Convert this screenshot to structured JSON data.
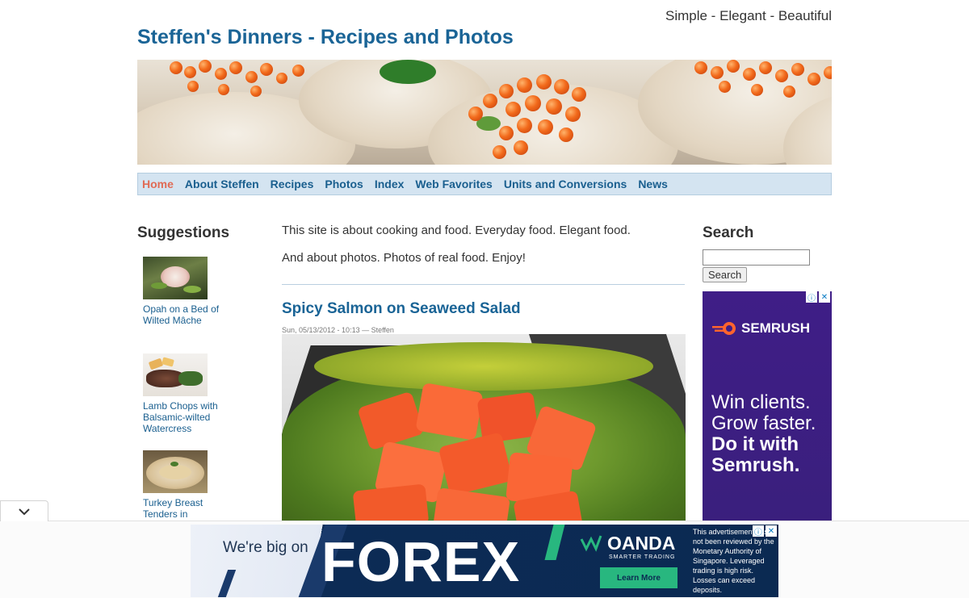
{
  "header": {
    "tagline": "Simple - Elegant - Beautiful",
    "site_title": "Steffen's Dinners - Recipes and Photos"
  },
  "nav": {
    "items": [
      "Home",
      "About Steffen",
      "Recipes",
      "Photos",
      "Index",
      "Web Favorites",
      "Units and Conversions",
      "News"
    ],
    "active": "Home"
  },
  "sidebar_left": {
    "title": "Suggestions",
    "items": [
      {
        "caption_line1": "Opah on a Bed of",
        "caption_line2": "Wilted Mâche"
      },
      {
        "caption_line1": "Lamb Chops with",
        "caption_line2": "Balsamic-wilted",
        "caption_line3": "Watercress"
      },
      {
        "caption_line1": "Turkey Breast",
        "caption_line2": "Tenders in"
      }
    ]
  },
  "main": {
    "intro_1": "This site is about cooking and food. Everyday food. Elegant food.",
    "intro_2": "And about photos. Photos of real food. Enjoy!",
    "article": {
      "title": "Spicy Salmon on Seaweed Salad",
      "meta": "Sun, 05/13/2012 - 10:13 — Steffen"
    }
  },
  "sidebar_right": {
    "title": "Search",
    "search_placeholder": "",
    "search_button": "Search",
    "ad": {
      "brand": "SEMRUSH",
      "line1": "Win clients.",
      "line2": "Grow faster.",
      "line3": "Do it with",
      "line4": "Semrush."
    }
  },
  "bottom_ad": {
    "tagline": "We're big on",
    "headline": "FOREX",
    "brand": "OANDA",
    "brand_sub": "SMARTER TRADING",
    "cta": "Learn More",
    "disclaimer": "This advertisement has not been reviewed by the Monetary Authority of Singapore. Leveraged trading is high risk. Losses can exceed deposits."
  },
  "colors": {
    "link": "#1a5f8f",
    "title": "#1a6496",
    "nav_active": "#e06b55",
    "nav_bg": "#d4e4f1",
    "ad_purple": "#3f1e87",
    "ad_orange": "#ff642d",
    "forex_navy": "#0b2a52",
    "forex_green": "#28b77f"
  },
  "icons": [
    "chevron-down-icon",
    "adchoices-icon",
    "close-icon",
    "semrush-logo-icon",
    "oanda-logo-icon"
  ]
}
